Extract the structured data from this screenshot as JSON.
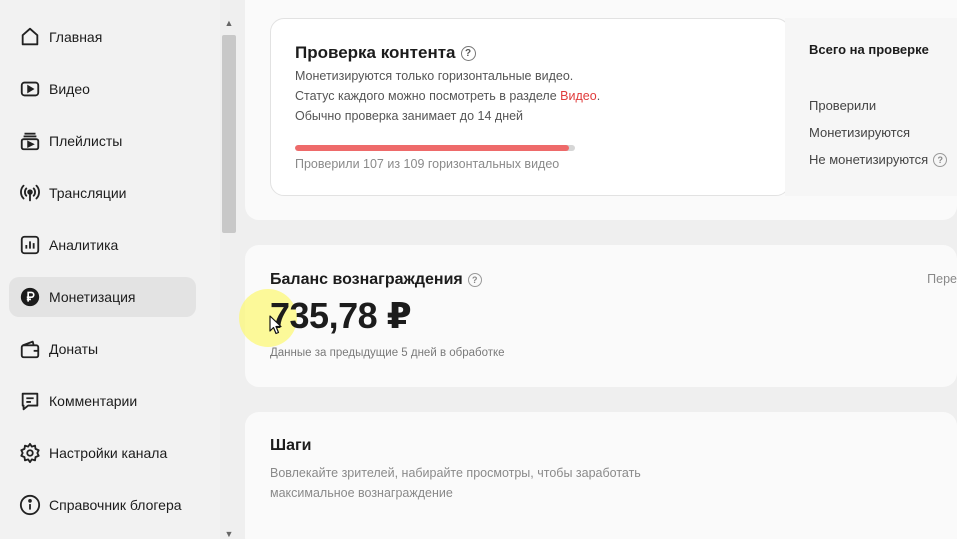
{
  "sidebar": {
    "items": [
      {
        "label": "Главная",
        "icon": "home-icon"
      },
      {
        "label": "Видео",
        "icon": "video-icon"
      },
      {
        "label": "Плейлисты",
        "icon": "playlist-icon"
      },
      {
        "label": "Трансляции",
        "icon": "broadcast-icon"
      },
      {
        "label": "Аналитика",
        "icon": "analytics-icon"
      },
      {
        "label": "Монетизация",
        "icon": "ruble-icon",
        "active": true
      },
      {
        "label": "Донаты",
        "icon": "wallet-icon"
      },
      {
        "label": "Комментарии",
        "icon": "comment-icon"
      },
      {
        "label": "Настройки канала",
        "icon": "gear-icon"
      },
      {
        "label": "Справочник блогера",
        "icon": "info-icon"
      }
    ]
  },
  "content_check": {
    "title": "Проверка контента",
    "line1": "Монетизируются только горизонтальные видео.",
    "line2_prefix": "Статус каждого можно посмотреть в разделе ",
    "line2_link": "Видео",
    "line2_suffix": ".",
    "line3": "Обычно проверка занимает до 14 дней",
    "progress_value": 0.98,
    "progress_text": "Проверили 107 из 109 горизонтальных видео"
  },
  "summary": {
    "title": "Всего на проверке",
    "checked": "Проверили",
    "monetized": "Монетизируются",
    "not_monetized": "Не монетизируются"
  },
  "balance": {
    "title": "Баланс вознаграждения",
    "amount": "735,78 ₽",
    "note": "Данные за предыдущие 5 дней в обработке",
    "right_link": "Пере"
  },
  "steps": {
    "title": "Шаги",
    "line1": "Вовлекайте зрителей, набирайте просмотры, чтобы заработать",
    "line2": "максимальное вознаграждение"
  },
  "colors": {
    "accent_red": "#e03b3b",
    "progress_fill": "#ee6a6a",
    "active_nav_bg": "#e3e3e3"
  }
}
